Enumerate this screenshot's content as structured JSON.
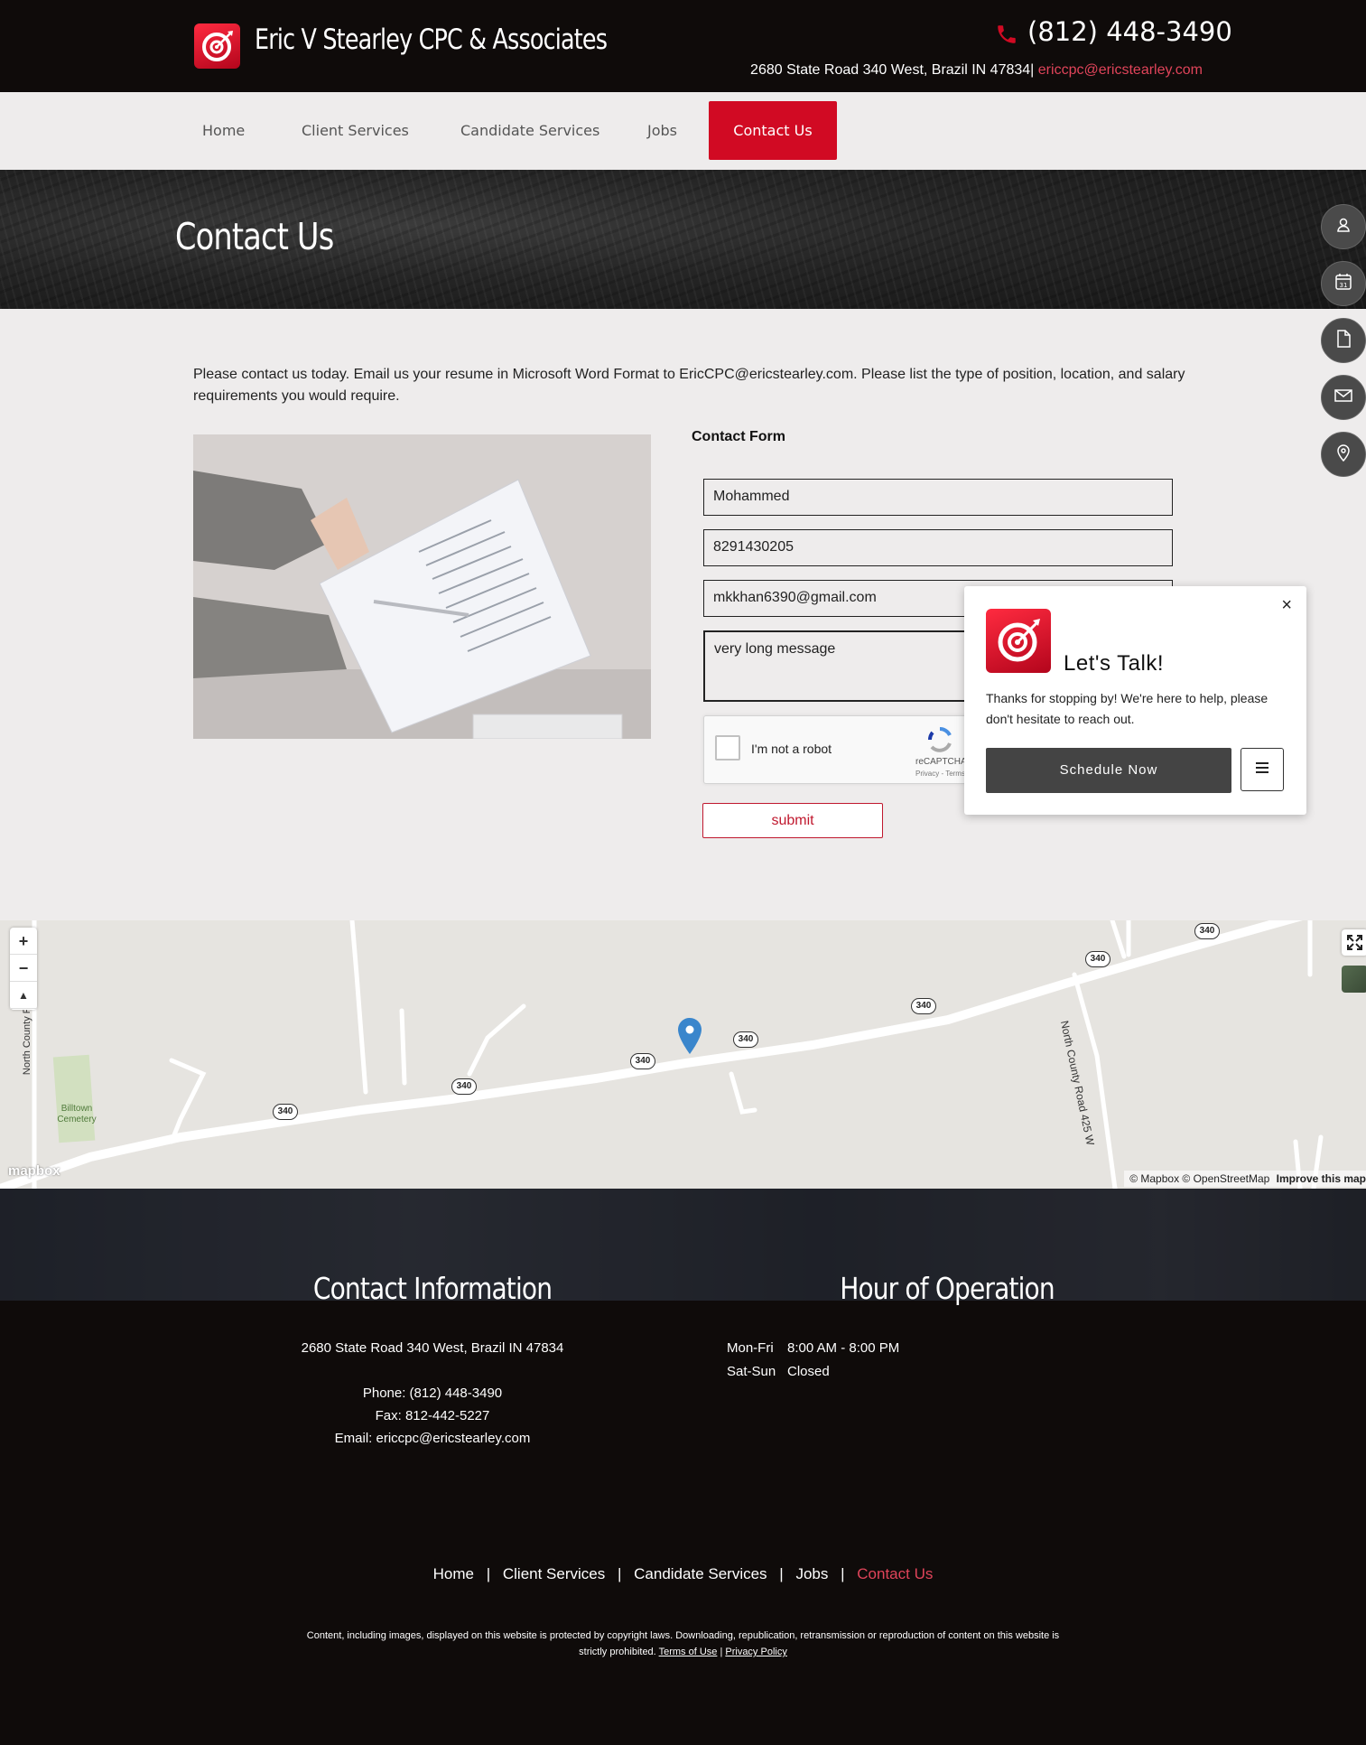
{
  "header": {
    "site_name": "Eric V Stearley CPC & Associates",
    "phone": "(812) 448-3490",
    "address": "2680 State Road 340 West, Brazil IN 47834|",
    "email": "ericcpc@ericstearley.com"
  },
  "nav": {
    "items": [
      {
        "label": "Home"
      },
      {
        "label": "Client Services"
      },
      {
        "label": "Candidate Services"
      },
      {
        "label": "Jobs"
      },
      {
        "label": "Contact Us",
        "active": true
      }
    ]
  },
  "hero": {
    "title": "Contact Us"
  },
  "side_buttons": [
    "user-icon",
    "calendar-icon",
    "document-icon",
    "mail-icon",
    "location-pin-icon"
  ],
  "intro_text": "Please contact us today. Email us your resume in Microsoft Word Format to EricCPC@ericstearley.com. Please list the type of position, location, and salary requirements you would require.",
  "form": {
    "heading": "Contact Form",
    "name_value": "Mohammed",
    "phone_value": "8291430205",
    "email_value": "mkkhan6390@gmail.com",
    "message_value": "very long message",
    "captcha_label": "I'm not a robot",
    "captcha_brand": "reCAPTCHA",
    "captcha_links": "Privacy - Terms",
    "submit_label": "submit"
  },
  "popup": {
    "close": "×",
    "title": "Let's Talk!",
    "text": "Thanks for stopping by! We're here to help, please don't hesitate to reach out.",
    "schedule_label": "Schedule Now"
  },
  "map": {
    "zoom_in": "+",
    "zoom_out": "−",
    "compass": "▲",
    "road_label_1": "North County Road 425 W",
    "road_label_2": "North County Road",
    "cemetery": "Billtown Cemetery",
    "route": "340",
    "attribution": "© Mapbox © OpenStreetMap",
    "improve": "Improve this map",
    "logo": "mapbox"
  },
  "footer": {
    "contact_heading": "Contact Information",
    "address": "2680 State Road 340 West, Brazil IN 47834",
    "phone": "Phone: (812) 448-3490",
    "fax": "Fax: 812-442-5227",
    "email": "Email: ericcpc@ericstearley.com",
    "hours_heading": "Hour of Operation",
    "hours": [
      {
        "day": "Mon-Fri",
        "time": "8:00 AM - 8:00 PM"
      },
      {
        "day": "Sat-Sun",
        "time": "Closed"
      }
    ],
    "nav": [
      "Home",
      "Client Services",
      "Candidate Services",
      "Jobs",
      "Contact Us"
    ],
    "copyright": "Content, including images, displayed on this website is protected by copyright laws. Downloading, republication, retransmission or reproduction of content on this website is strictly prohibited.",
    "terms": "Terms of Use",
    "separator": "|",
    "privacy": "Privacy Policy"
  },
  "colors": {
    "brand_red": "#d10a23",
    "dark": "#0f0b0a",
    "link_red": "#e0445a"
  }
}
